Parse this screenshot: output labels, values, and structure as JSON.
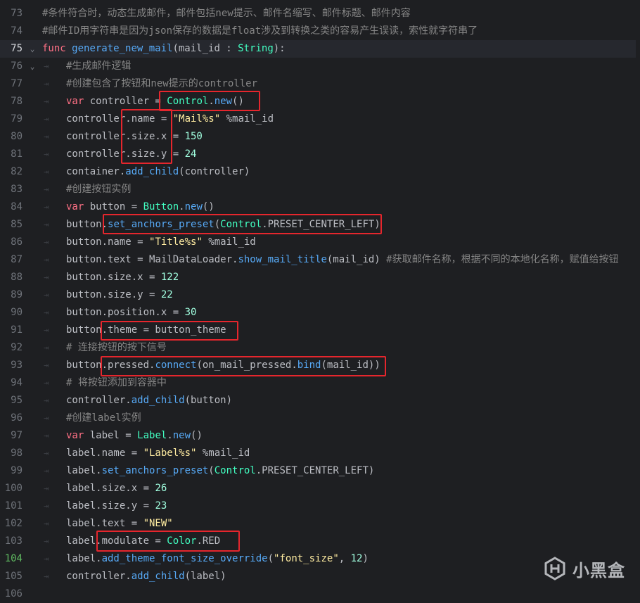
{
  "editor": {
    "lines": [
      {
        "n": "73",
        "indent": 0,
        "fold": "",
        "current": false,
        "mod": false,
        "tokens": [
          [
            "cm",
            "#条件符合时，动态生成邮件，邮件包括new提示、邮件名缩写、邮件标题、邮件内容"
          ]
        ]
      },
      {
        "n": "74",
        "indent": 0,
        "fold": "",
        "current": false,
        "mod": false,
        "tokens": [
          [
            "cm",
            "#邮件ID用字符串是因为json保存的数据是float涉及到转换之类的容易产生误读，索性就字符串了"
          ]
        ]
      },
      {
        "n": "75",
        "indent": 0,
        "fold": "⌄",
        "current": true,
        "mod": false,
        "tokens": [
          [
            "kw",
            "func "
          ],
          [
            "fn",
            "generate_new_mail"
          ],
          [
            "p",
            "(mail_id : "
          ],
          [
            "cls",
            "String"
          ],
          [
            "p",
            "):"
          ]
        ]
      },
      {
        "n": "76",
        "indent": 1,
        "fold": "⌄",
        "current": false,
        "mod": false,
        "tokens": [
          [
            "cm",
            "#生成邮件逻辑"
          ]
        ]
      },
      {
        "n": "77",
        "indent": 1,
        "fold": "",
        "current": false,
        "mod": false,
        "tokens": [
          [
            "cm",
            "#创建包含了按钮和new提示的controller"
          ]
        ]
      },
      {
        "n": "78",
        "indent": 1,
        "fold": "",
        "current": false,
        "mod": false,
        "tokens": [
          [
            "kw",
            "var "
          ],
          [
            "p",
            "controller = "
          ],
          [
            "cls",
            "Control"
          ],
          [
            "p",
            "."
          ],
          [
            "fn",
            "new"
          ],
          [
            "p",
            "()"
          ]
        ]
      },
      {
        "n": "79",
        "indent": 1,
        "fold": "",
        "current": false,
        "mod": false,
        "tokens": [
          [
            "p",
            "controller.name = "
          ],
          [
            "str",
            "\"Mail%s\""
          ],
          [
            "p",
            " %mail_id"
          ]
        ]
      },
      {
        "n": "80",
        "indent": 1,
        "fold": "",
        "current": false,
        "mod": false,
        "tokens": [
          [
            "p",
            "controller.size.x = "
          ],
          [
            "num",
            "150"
          ]
        ]
      },
      {
        "n": "81",
        "indent": 1,
        "fold": "",
        "current": false,
        "mod": false,
        "tokens": [
          [
            "p",
            "controller.size.y = "
          ],
          [
            "num",
            "24"
          ]
        ]
      },
      {
        "n": "82",
        "indent": 1,
        "fold": "",
        "current": false,
        "mod": false,
        "tokens": [
          [
            "p",
            "container."
          ],
          [
            "fn",
            "add_child"
          ],
          [
            "p",
            "(controller)"
          ]
        ]
      },
      {
        "n": "83",
        "indent": 1,
        "fold": "",
        "current": false,
        "mod": false,
        "tokens": [
          [
            "cm",
            "#创建按钮实例"
          ]
        ]
      },
      {
        "n": "84",
        "indent": 1,
        "fold": "",
        "current": false,
        "mod": false,
        "tokens": [
          [
            "kw",
            "var "
          ],
          [
            "p",
            "button = "
          ],
          [
            "cls",
            "Button"
          ],
          [
            "p",
            "."
          ],
          [
            "fn",
            "new"
          ],
          [
            "p",
            "()"
          ]
        ]
      },
      {
        "n": "85",
        "indent": 1,
        "fold": "",
        "current": false,
        "mod": false,
        "tokens": [
          [
            "p",
            "button."
          ],
          [
            "fn",
            "set_anchors_preset"
          ],
          [
            "p",
            "("
          ],
          [
            "cls",
            "Control"
          ],
          [
            "p",
            ".PRESET_CENTER_LEFT)"
          ]
        ]
      },
      {
        "n": "86",
        "indent": 1,
        "fold": "",
        "current": false,
        "mod": false,
        "tokens": [
          [
            "p",
            "button.name = "
          ],
          [
            "str",
            "\"Title%s\""
          ],
          [
            "p",
            " %mail_id"
          ]
        ]
      },
      {
        "n": "87",
        "indent": 1,
        "fold": "",
        "current": false,
        "mod": false,
        "tokens": [
          [
            "p",
            "button.text = MailDataLoader."
          ],
          [
            "fn",
            "show_mail_title"
          ],
          [
            "p",
            "(mail_id) "
          ],
          [
            "cm",
            "#获取邮件名称，根据不同的本地化名称，赋值给按钮"
          ]
        ]
      },
      {
        "n": "88",
        "indent": 1,
        "fold": "",
        "current": false,
        "mod": false,
        "tokens": [
          [
            "p",
            "button.size.x = "
          ],
          [
            "num",
            "122"
          ]
        ]
      },
      {
        "n": "89",
        "indent": 1,
        "fold": "",
        "current": false,
        "mod": false,
        "tokens": [
          [
            "p",
            "button.size.y = "
          ],
          [
            "num",
            "22"
          ]
        ]
      },
      {
        "n": "90",
        "indent": 1,
        "fold": "",
        "current": false,
        "mod": false,
        "tokens": [
          [
            "p",
            "button.position.x = "
          ],
          [
            "num",
            "30"
          ]
        ]
      },
      {
        "n": "91",
        "indent": 1,
        "fold": "",
        "current": false,
        "mod": false,
        "tokens": [
          [
            "p",
            "button.theme = button_theme"
          ]
        ]
      },
      {
        "n": "92",
        "indent": 1,
        "fold": "",
        "current": false,
        "mod": false,
        "tokens": [
          [
            "cm",
            "# 连接按钮的按下信号"
          ]
        ]
      },
      {
        "n": "93",
        "indent": 1,
        "fold": "",
        "current": false,
        "mod": false,
        "tokens": [
          [
            "p",
            "button.pressed."
          ],
          [
            "fn",
            "connect"
          ],
          [
            "p",
            "(on_mail_pressed."
          ],
          [
            "fn",
            "bind"
          ],
          [
            "p",
            "(mail_id))"
          ]
        ]
      },
      {
        "n": "94",
        "indent": 1,
        "fold": "",
        "current": false,
        "mod": false,
        "tokens": [
          [
            "cm",
            "# 将按钮添加到容器中"
          ]
        ]
      },
      {
        "n": "95",
        "indent": 1,
        "fold": "",
        "current": false,
        "mod": false,
        "tokens": [
          [
            "p",
            "controller."
          ],
          [
            "fn",
            "add_child"
          ],
          [
            "p",
            "(button)"
          ]
        ]
      },
      {
        "n": "96",
        "indent": 1,
        "fold": "",
        "current": false,
        "mod": false,
        "tokens": [
          [
            "cm",
            "#创建label实例"
          ]
        ]
      },
      {
        "n": "97",
        "indent": 1,
        "fold": "",
        "current": false,
        "mod": false,
        "tokens": [
          [
            "kw",
            "var "
          ],
          [
            "p",
            "label = "
          ],
          [
            "cls",
            "Label"
          ],
          [
            "p",
            "."
          ],
          [
            "fn",
            "new"
          ],
          [
            "p",
            "()"
          ]
        ]
      },
      {
        "n": "98",
        "indent": 1,
        "fold": "",
        "current": false,
        "mod": false,
        "tokens": [
          [
            "p",
            "label.name = "
          ],
          [
            "str",
            "\"Label%s\""
          ],
          [
            "p",
            " %mail_id"
          ]
        ]
      },
      {
        "n": "99",
        "indent": 1,
        "fold": "",
        "current": false,
        "mod": false,
        "tokens": [
          [
            "p",
            "label."
          ],
          [
            "fn",
            "set_anchors_preset"
          ],
          [
            "p",
            "("
          ],
          [
            "cls",
            "Control"
          ],
          [
            "p",
            ".PRESET_CENTER_LEFT)"
          ]
        ]
      },
      {
        "n": "100",
        "indent": 1,
        "fold": "",
        "current": false,
        "mod": false,
        "tokens": [
          [
            "p",
            "label.size.x = "
          ],
          [
            "num",
            "26"
          ]
        ]
      },
      {
        "n": "101",
        "indent": 1,
        "fold": "",
        "current": false,
        "mod": false,
        "tokens": [
          [
            "p",
            "label.size.y = "
          ],
          [
            "num",
            "23"
          ]
        ]
      },
      {
        "n": "102",
        "indent": 1,
        "fold": "",
        "current": false,
        "mod": false,
        "tokens": [
          [
            "p",
            "label.text = "
          ],
          [
            "str",
            "\"NEW\""
          ]
        ]
      },
      {
        "n": "103",
        "indent": 1,
        "fold": "",
        "current": false,
        "mod": false,
        "tokens": [
          [
            "p",
            "label.modulate = "
          ],
          [
            "cls",
            "Color"
          ],
          [
            "p",
            ".RED"
          ]
        ]
      },
      {
        "n": "104",
        "indent": 1,
        "fold": "",
        "current": false,
        "mod": true,
        "tokens": [
          [
            "p",
            "label."
          ],
          [
            "fn",
            "add_theme_font_size_override"
          ],
          [
            "p",
            "("
          ],
          [
            "str",
            "\"font_size\""
          ],
          [
            "p",
            ", "
          ],
          [
            "num",
            "12"
          ],
          [
            "p",
            ")"
          ]
        ]
      },
      {
        "n": "105",
        "indent": 1,
        "fold": "",
        "current": false,
        "mod": false,
        "tokens": [
          [
            "p",
            "controller."
          ],
          [
            "fn",
            "add_child"
          ],
          [
            "p",
            "(label)"
          ]
        ]
      },
      {
        "n": "106",
        "indent": 0,
        "fold": "",
        "current": false,
        "mod": false,
        "tokens": []
      }
    ]
  },
  "watermark": {
    "text": "小黑盒"
  }
}
